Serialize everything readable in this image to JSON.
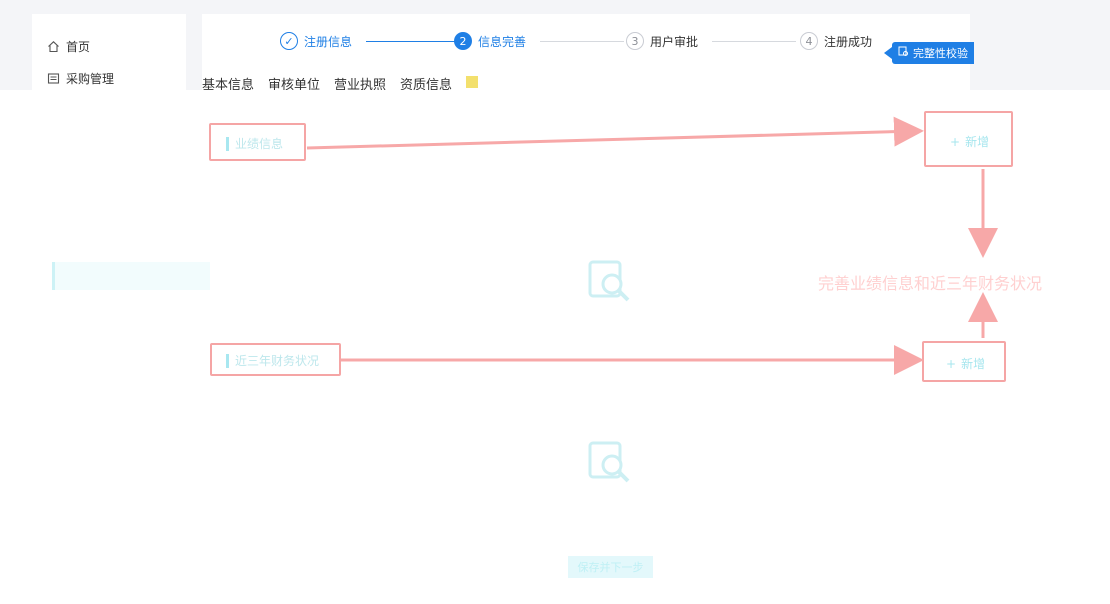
{
  "sidebar": {
    "items": [
      {
        "label": "首页",
        "icon": "home-icon"
      },
      {
        "label": "采购管理",
        "icon": "document-icon"
      }
    ]
  },
  "steps": [
    {
      "num": "✓",
      "label": "注册信息",
      "state": "done"
    },
    {
      "num": "2",
      "label": "信息完善",
      "state": "active"
    },
    {
      "num": "3",
      "label": "用户审批",
      "state": "wait"
    },
    {
      "num": "4",
      "label": "注册成功",
      "state": "wait"
    }
  ],
  "integrity_button": "完整性校验",
  "tabs": [
    "基本信息",
    "审核单位",
    "营业执照",
    "资质信息"
  ],
  "sections": [
    {
      "label": "业绩信息",
      "add": "新增"
    },
    {
      "label": "近三年财务状况",
      "add": "新增"
    }
  ],
  "annotation": "完善业绩信息和近三年财务状况",
  "save_button": "保存并下一步",
  "colors": {
    "primary": "#1f7fe5",
    "annotation_red": "#f5a5a5",
    "ghost_cyan": "#a8e7f0"
  }
}
